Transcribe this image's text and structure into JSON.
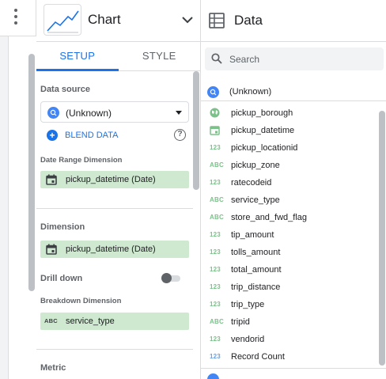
{
  "chart_panel": {
    "title": "Chart",
    "tabs": [
      {
        "label": "SETUP",
        "active": true
      },
      {
        "label": "STYLE",
        "active": false
      }
    ]
  },
  "setup": {
    "data_source_label": "Data source",
    "data_source_value": "(Unknown)",
    "blend_label": "BLEND DATA",
    "help_glyph": "?",
    "date_range_label": "Date Range Dimension",
    "date_range_value": "pickup_datetime (Date)",
    "dimension_label": "Dimension",
    "dimension_value": "pickup_datetime (Date)",
    "drill_down_label": "Drill down",
    "drill_down_on": false,
    "breakdown_label": "Breakdown Dimension",
    "breakdown_value": "service_type",
    "breakdown_type": "ABC",
    "metric_label": "Metric"
  },
  "data_panel": {
    "title": "Data",
    "search_placeholder": "Search",
    "source_name": "(Unknown)",
    "fields": [
      {
        "type": "geo",
        "label": "pickup_borough"
      },
      {
        "type": "date",
        "label": "pickup_datetime"
      },
      {
        "type": "123",
        "label": "pickup_locationid"
      },
      {
        "type": "ABC",
        "label": "pickup_zone"
      },
      {
        "type": "123",
        "label": "ratecodeid"
      },
      {
        "type": "ABC",
        "label": "service_type"
      },
      {
        "type": "ABC",
        "label": "store_and_fwd_flag"
      },
      {
        "type": "123",
        "label": "tip_amount"
      },
      {
        "type": "123",
        "label": "tolls_amount"
      },
      {
        "type": "123",
        "label": "total_amount"
      },
      {
        "type": "123",
        "label": "trip_distance"
      },
      {
        "type": "123",
        "label": "trip_type"
      },
      {
        "type": "ABC",
        "label": "tripid"
      },
      {
        "type": "123",
        "label": "vendorid"
      },
      {
        "type": "123-blue",
        "label": "Record Count"
      }
    ]
  },
  "colors": {
    "accent": "#1a73e8",
    "dimension_chip": "#cfe8d0",
    "dimension_type": "#7cc18a",
    "metric_type": "#6b9fe6"
  }
}
